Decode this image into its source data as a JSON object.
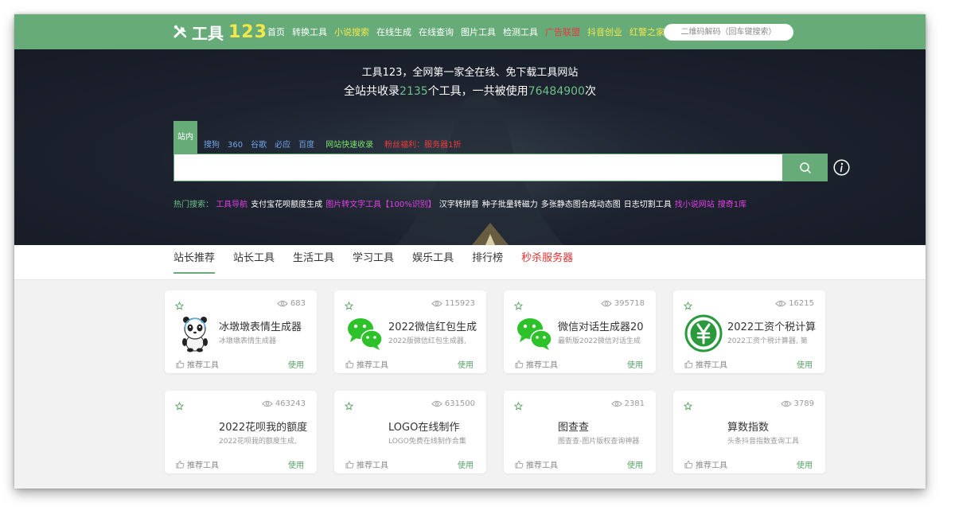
{
  "header": {
    "logo_text": "工具",
    "logo_num": "123",
    "nav": [
      {
        "label": "首页",
        "color": "#ffffff"
      },
      {
        "label": "转换工具",
        "color": "#ffffff"
      },
      {
        "label": "小说搜索",
        "color": "#f3e84a"
      },
      {
        "label": "在线生成",
        "color": "#ffffff"
      },
      {
        "label": "在线查询",
        "color": "#ffffff"
      },
      {
        "label": "图片工具",
        "color": "#ffffff"
      },
      {
        "label": "检测工具",
        "color": "#ffffff"
      },
      {
        "label": "广告联盟",
        "color": "#e8373d"
      },
      {
        "label": "抖音创业",
        "color": "#f3e84a"
      },
      {
        "label": "红警之家",
        "color": "#f3e84a"
      }
    ],
    "qr_placeholder": "二维码解码（回车键搜索）"
  },
  "hero": {
    "line1": "工具123，全网第一家全在线、免下载工具网站",
    "line2_a": "全站共收录",
    "tool_count": "2135",
    "line2_b": "个工具，一共被使用",
    "use_count": "76484900",
    "line2_c": "次"
  },
  "search": {
    "tabs": [
      "站内",
      "搜狗",
      "360",
      "谷歌",
      "必应",
      "百度"
    ],
    "extra_green": "网站快速收录",
    "extra_red": "粉丝福利：服务器1折",
    "input_value": ""
  },
  "hot": {
    "label": "热门搜索：",
    "items": [
      {
        "text": "工具导航",
        "cls": "pink"
      },
      {
        "text": "支付宝花呗额度生成",
        "cls": "white"
      },
      {
        "text": "图片转文字工具【100%识别】",
        "cls": "pink"
      },
      {
        "text": "汉字转拼音",
        "cls": "white"
      },
      {
        "text": "种子批量转磁力",
        "cls": "white"
      },
      {
        "text": "多张静态图合成动态图",
        "cls": "white"
      },
      {
        "text": "日志切割工具",
        "cls": "white"
      },
      {
        "text": "找小说网站",
        "cls": "pink"
      },
      {
        "text": "搜奇1库",
        "cls": "pink"
      }
    ]
  },
  "categories": [
    {
      "label": "站长推荐",
      "active": true,
      "red": false
    },
    {
      "label": "站长工具",
      "active": false,
      "red": false
    },
    {
      "label": "生活工具",
      "active": false,
      "red": false
    },
    {
      "label": "学习工具",
      "active": false,
      "red": false
    },
    {
      "label": "娱乐工具",
      "active": false,
      "red": false
    },
    {
      "label": "排行榜",
      "active": false,
      "red": false
    },
    {
      "label": "秒杀服务器",
      "active": false,
      "red": true
    }
  ],
  "cards": [
    {
      "views": "683",
      "title": "冰墩墩表情生成器",
      "desc": "冰墩墩表情生成器",
      "icon": "panda-icon",
      "rec": "推荐工具",
      "use": "使用"
    },
    {
      "views": "115923",
      "title": "2022微信红包生成",
      "desc": "2022版微信红包生成器,",
      "icon": "wechat-icon",
      "rec": "推荐工具",
      "use": "使用"
    },
    {
      "views": "395718",
      "title": "微信对话生成器20",
      "desc": "最新版2022微信对话生成",
      "icon": "wechat-icon",
      "rec": "推荐工具",
      "use": "使用"
    },
    {
      "views": "16215",
      "title": "2022工资个税计算",
      "desc": "2022工资个税计算器, 第",
      "icon": "yen-icon",
      "rec": "推荐工具",
      "use": "使用"
    },
    {
      "views": "463243",
      "title": "2022花呗我的额度",
      "desc": "2022花呗我的额度生成,",
      "icon": "",
      "rec": "推荐工具",
      "use": "使用"
    },
    {
      "views": "631500",
      "title": "LOGO在线制作",
      "desc": "LOGO免费在线制作合集",
      "icon": "",
      "rec": "推荐工具",
      "use": "使用"
    },
    {
      "views": "2381",
      "title": "图查查",
      "desc": "图查查-图片版权查询神器",
      "icon": "",
      "rec": "推荐工具",
      "use": "使用"
    },
    {
      "views": "3789",
      "title": "算数指数",
      "desc": "头条抖音指数查询工具",
      "icon": "",
      "rec": "推荐工具",
      "use": "使用"
    }
  ]
}
